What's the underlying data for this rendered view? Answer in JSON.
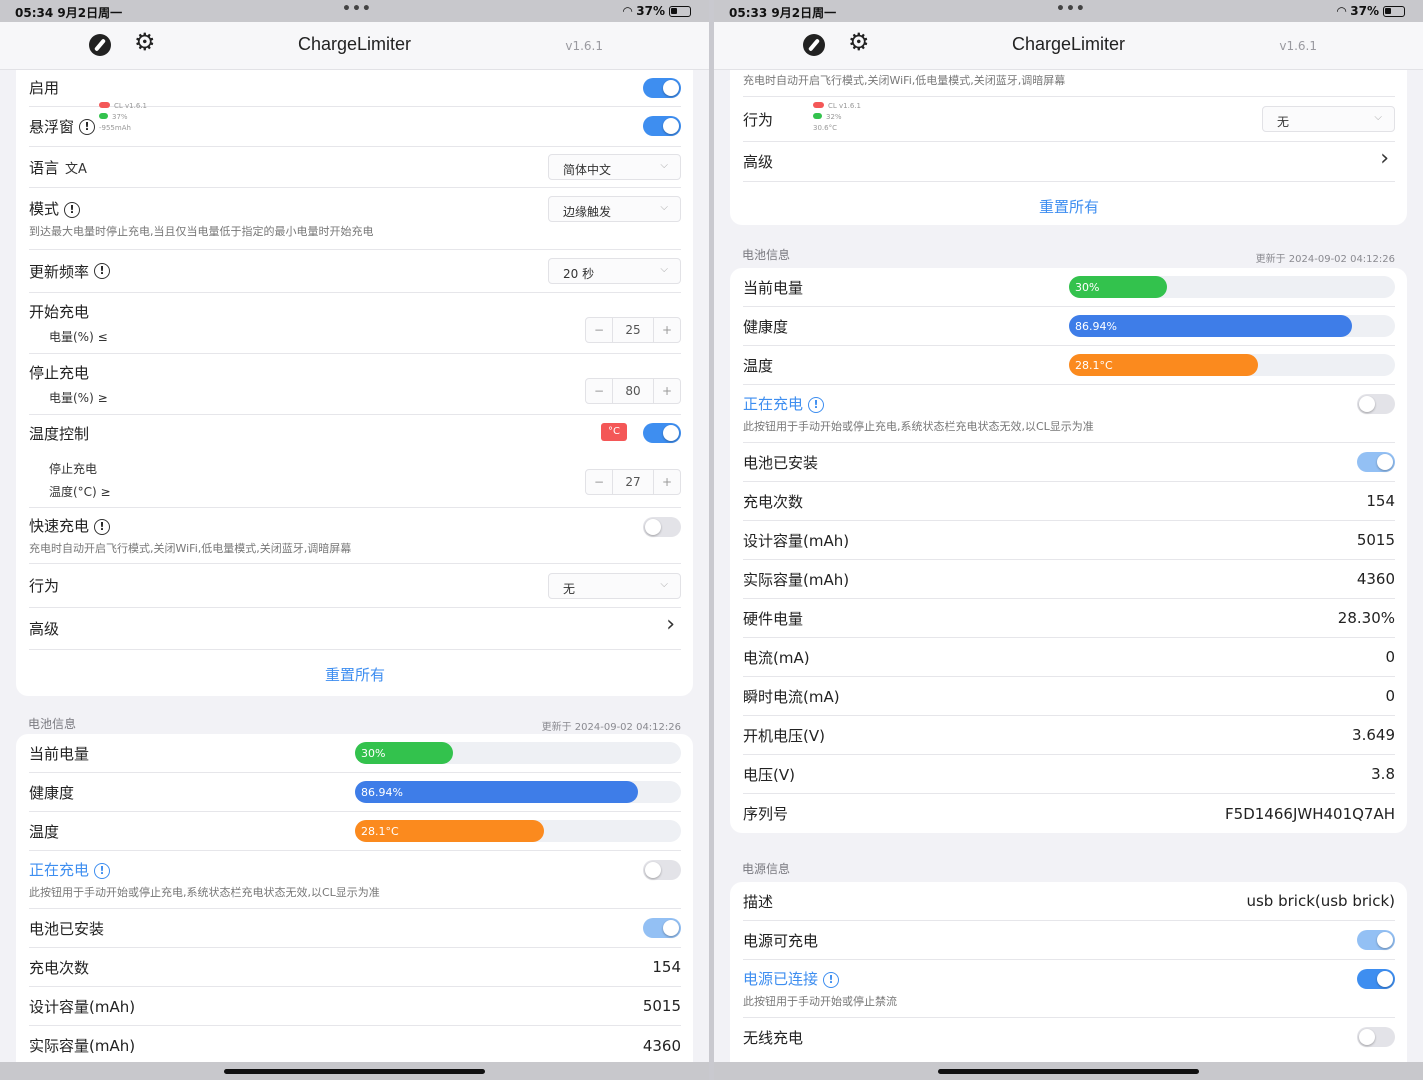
{
  "left": {
    "status": {
      "time": "05:34",
      "date": "9月2日周一",
      "battery": "37%"
    },
    "nav": {
      "title": "ChargeLimiter",
      "version": "v1.6.1"
    },
    "settings": {
      "enable": "启用",
      "floating": "悬浮窗",
      "floating_preview": [
        "CL v1.6.1",
        "37%",
        "-955mAh"
      ],
      "language": "语言",
      "language_value": "简体中文",
      "mode": "模式",
      "mode_value": "边缘触发",
      "mode_desc": "到达最大电量时停止充电,当且仅当电量低于指定的最小电量时开始充电",
      "update_freq": "更新频率",
      "update_freq_value": "20 秒",
      "start_charge": "开始充电",
      "start_sub": "电量(%) ≤",
      "start_value": "25",
      "stop_charge": "停止充电",
      "stop_sub": "电量(%) ≥",
      "stop_value": "80",
      "temp_control": "温度控制",
      "temp_badge": "°C",
      "temp_stop": "停止充电",
      "temp_sub": "温度(°C) ≥",
      "temp_value": "27",
      "fast_charge": "快速充电",
      "fast_desc": "充电时自动开启飞行模式,关闭WiFi,低电量模式,关闭蓝牙,调暗屏幕",
      "action": "行为",
      "action_value": "无",
      "advanced": "高级",
      "reset": "重置所有"
    },
    "battery": {
      "section": "电池信息",
      "updated": "更新于 2024-09-02 04:12:26",
      "current": "当前电量",
      "current_value": "30%",
      "health": "健康度",
      "health_value": "86.94%",
      "temp": "温度",
      "temp_value": "28.1°C",
      "charging": "正在充电",
      "charging_desc": "此按钮用于手动开始或停止充电,系统状态栏充电状态无效,以CL显示为准",
      "installed": "电池已安装",
      "cycles": "充电次数",
      "cycles_value": "154",
      "design_cap": "设计容量(mAh)",
      "design_cap_value": "5015",
      "actual_cap": "实际容量(mAh)",
      "actual_cap_value": "4360"
    }
  },
  "right": {
    "status": {
      "time": "05:33",
      "date": "9月2日周一",
      "battery": "37%"
    },
    "nav": {
      "title": "ChargeLimiter",
      "version": "v1.6.1"
    },
    "settings": {
      "fast_desc": "充电时自动开启飞行模式,关闭WiFi,低电量模式,关闭蓝牙,调暗屏幕",
      "action": "行为",
      "action_preview": [
        "CL v1.6.1",
        "32%",
        "30.6°C"
      ],
      "action_value": "无",
      "advanced": "高级",
      "reset": "重置所有"
    },
    "battery": {
      "section": "电池信息",
      "updated": "更新于 2024-09-02 04:12:26",
      "current": "当前电量",
      "current_value": "30%",
      "health": "健康度",
      "health_value": "86.94%",
      "temp": "温度",
      "temp_value": "28.1°C",
      "charging": "正在充电",
      "charging_desc": "此按钮用于手动开始或停止充电,系统状态栏充电状态无效,以CL显示为准",
      "installed": "电池已安装",
      "cycles": "充电次数",
      "cycles_value": "154",
      "design_cap": "设计容量(mAh)",
      "design_cap_value": "5015",
      "actual_cap": "实际容量(mAh)",
      "actual_cap_value": "4360",
      "hw_level": "硬件电量",
      "hw_level_value": "28.30%",
      "current_ma": "电流(mA)",
      "current_ma_value": "0",
      "inst_current": "瞬时电流(mA)",
      "inst_current_value": "0",
      "boot_voltage": "开机电压(V)",
      "boot_voltage_value": "3.649",
      "voltage": "电压(V)",
      "voltage_value": "3.8",
      "serial": "序列号",
      "serial_value": "F5D1466JWH401Q7AH"
    },
    "power": {
      "section": "电源信息",
      "desc": "描述",
      "desc_value": "usb brick(usb brick)",
      "chargeable": "电源可充电",
      "connected": "电源已连接",
      "connected_desc": "此按钮用于手动开始或停止禁流",
      "wireless": "无线充电"
    }
  },
  "bars": {
    "current_pct": 30,
    "health_pct": 86.94,
    "temp_pct": 58
  },
  "colors": {
    "accent": "#3e8ef0",
    "green": "#33c24d",
    "blue": "#3e7de8",
    "orange": "#fb8a1e",
    "red": "#f45757"
  }
}
